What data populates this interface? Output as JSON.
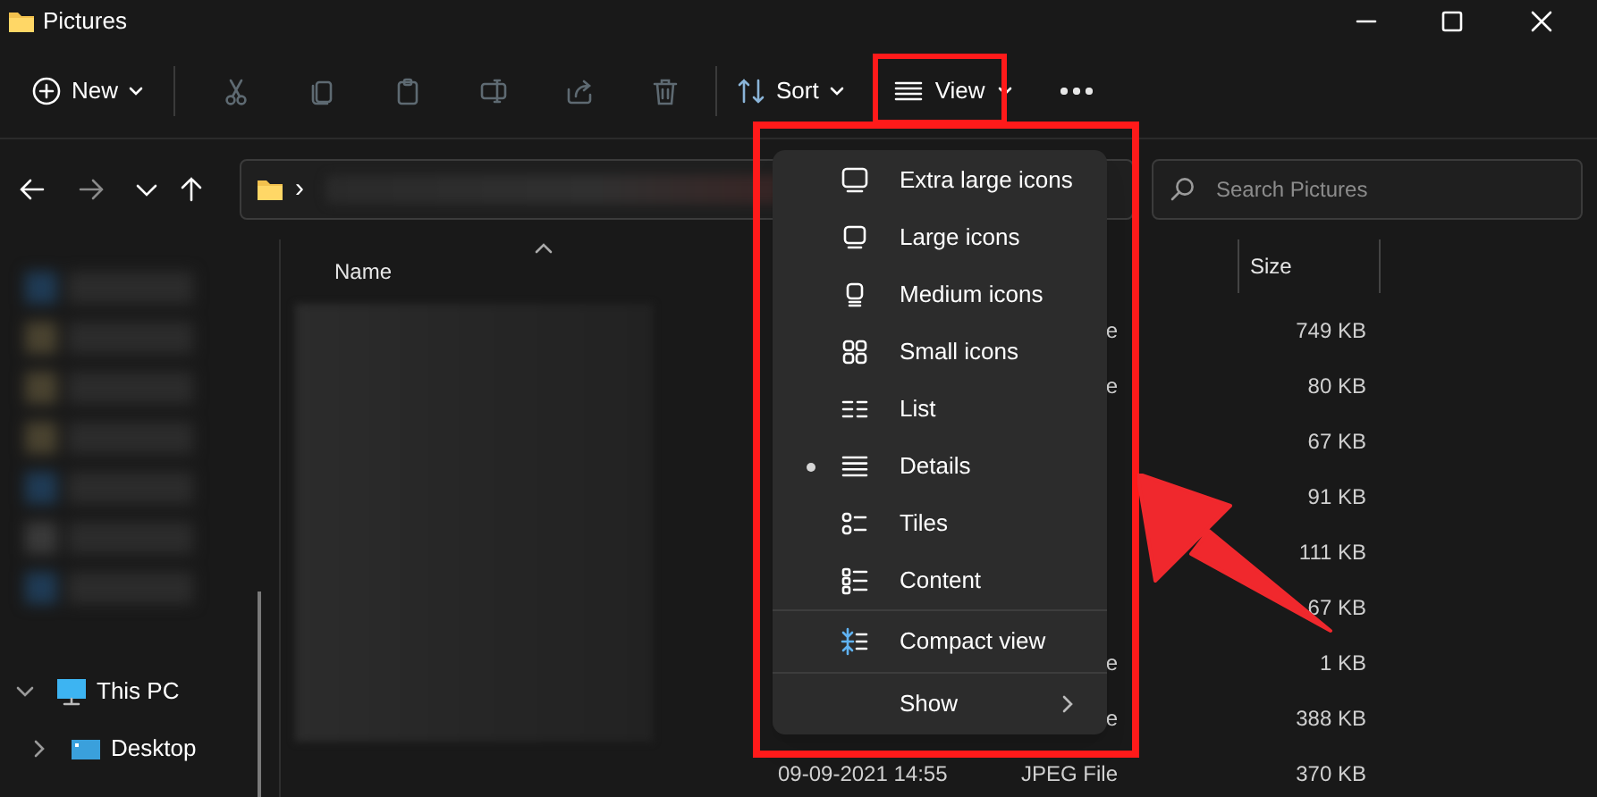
{
  "window": {
    "title": "Pictures"
  },
  "toolbar": {
    "new": "New",
    "actions": [
      {
        "kind": "cut",
        "disabled": true
      },
      {
        "kind": "copy",
        "disabled": true
      },
      {
        "kind": "paste",
        "disabled": true
      },
      {
        "kind": "rename",
        "disabled": true
      },
      {
        "kind": "share",
        "disabled": true
      },
      {
        "kind": "delete",
        "disabled": true
      }
    ],
    "sort": "Sort",
    "view": "View"
  },
  "nav": [
    {
      "kind": "back",
      "disabled": false
    },
    {
      "kind": "forward",
      "disabled": true
    },
    {
      "kind": "recent",
      "disabled": false
    },
    {
      "kind": "up",
      "disabled": false
    }
  ],
  "address": {
    "separator": "›"
  },
  "search": {
    "placeholder": "Search Pictures"
  },
  "sidebar": [
    {
      "label": "This PC",
      "expanded": true,
      "children": [
        {
          "label": "Desktop",
          "expanded": false
        }
      ]
    }
  ],
  "columns": [
    {
      "label": "Name",
      "sorted": true
    },
    {
      "label": "Size",
      "sorted": false
    }
  ],
  "rows": [
    {
      "type": "e",
      "size": "749 KB"
    },
    {
      "type": "e",
      "size": "80 KB"
    },
    {
      "size": "67 KB"
    },
    {
      "size": "91 KB"
    },
    {
      "size": "111 KB"
    },
    {
      "size": "67 KB"
    },
    {
      "type": "e",
      "size": "1 KB"
    },
    {
      "type": "e",
      "size": "388 KB"
    },
    {
      "date": "09-09-2021 14:55",
      "type": "JPEG File",
      "size": "370 KB"
    }
  ],
  "view_menu": {
    "items": [
      {
        "kind": "view",
        "label": "Extra large icons",
        "selected": false
      },
      {
        "kind": "view",
        "label": "Large icons",
        "selected": false
      },
      {
        "kind": "view",
        "label": "Medium icons",
        "selected": false
      },
      {
        "kind": "view",
        "label": "Small icons",
        "selected": false
      },
      {
        "kind": "view",
        "label": "List",
        "selected": false
      },
      {
        "kind": "view",
        "label": "Details",
        "selected": true
      },
      {
        "kind": "view",
        "label": "Tiles",
        "selected": false
      },
      {
        "kind": "view",
        "label": "Content",
        "selected": false
      },
      {
        "kind": "toggle",
        "label": "Compact view"
      },
      {
        "kind": "submenu",
        "label": "Show"
      }
    ]
  }
}
